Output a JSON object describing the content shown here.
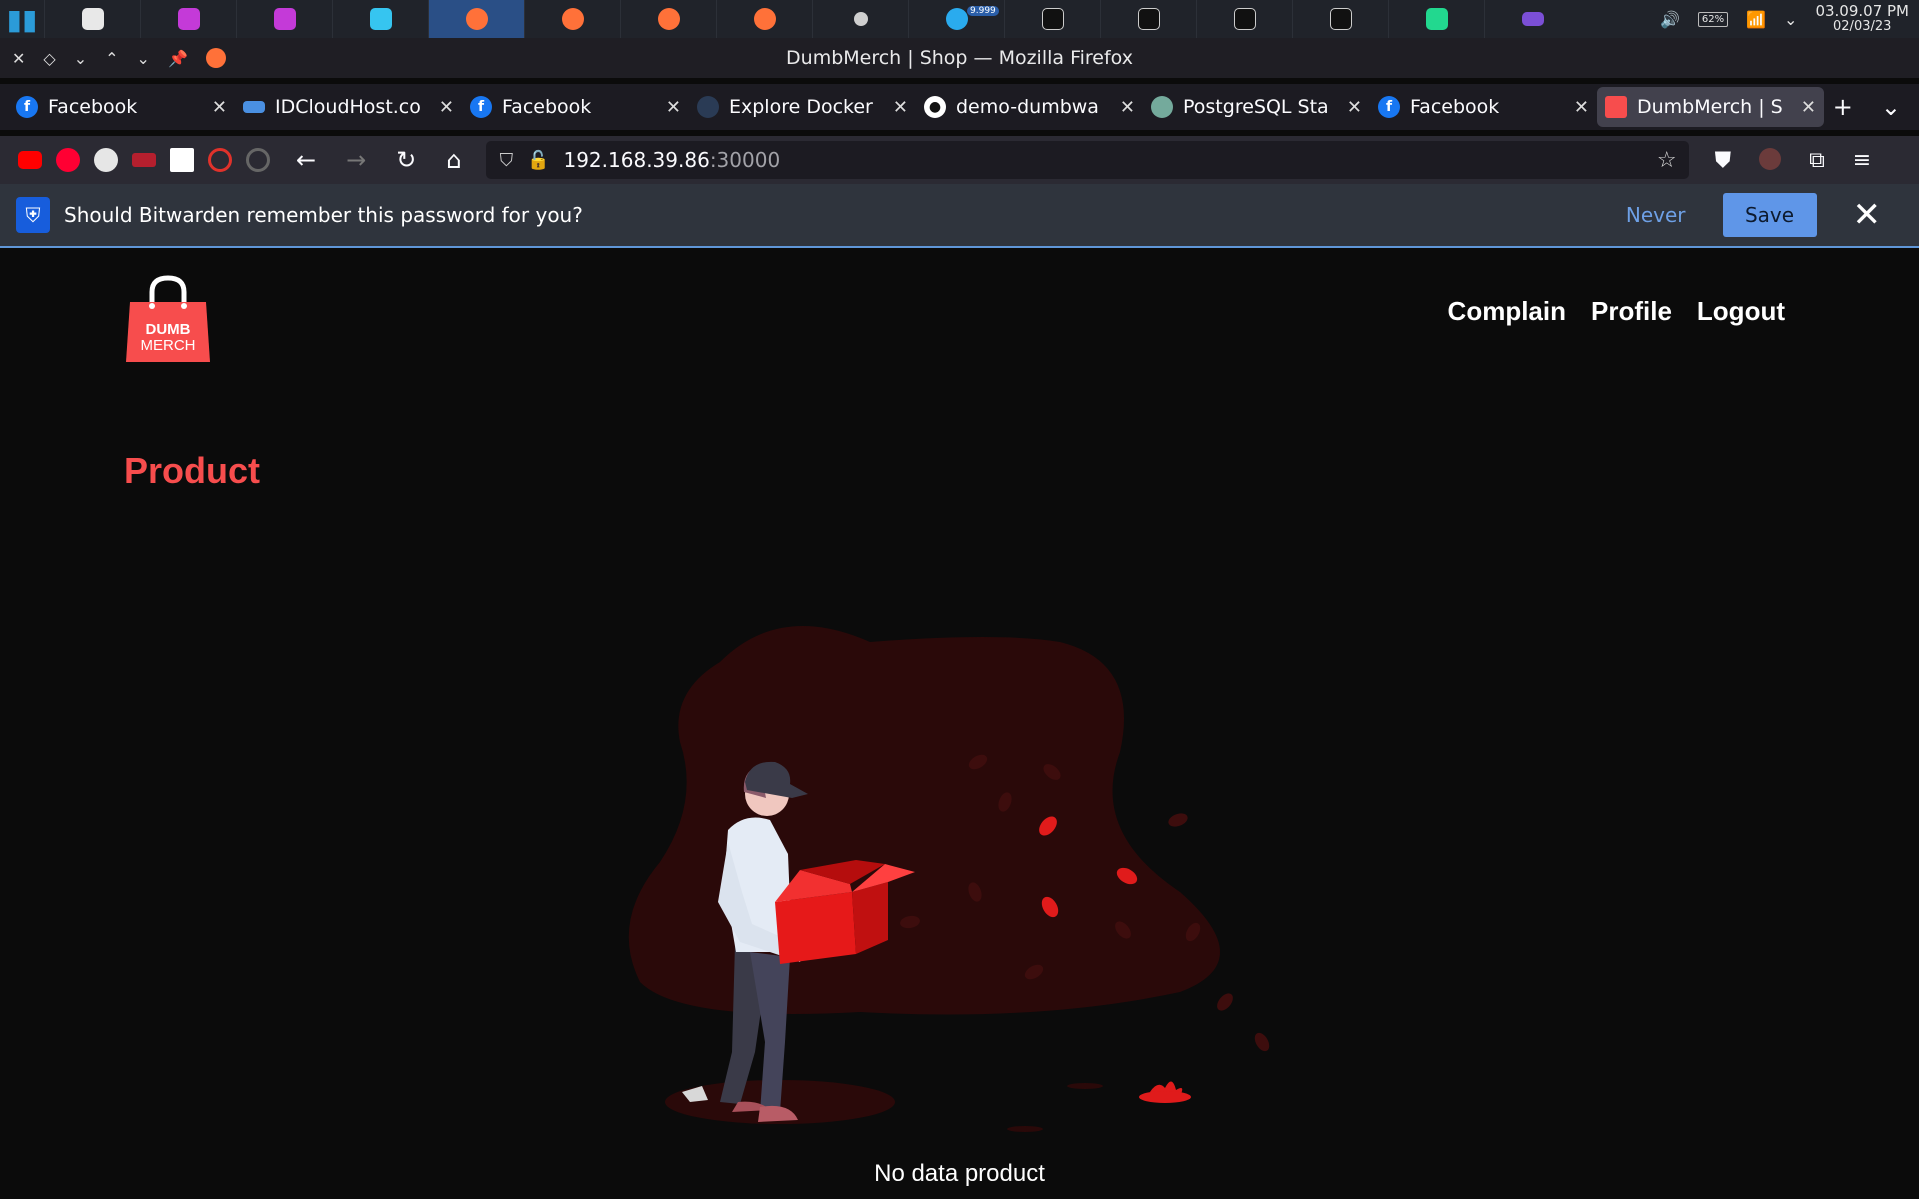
{
  "taskbar": {
    "badge": "9.999",
    "battery": "62%",
    "time": "03.09.07 PM",
    "date": "02/03/23"
  },
  "window": {
    "title": "DumbMerch | Shop — Mozilla Firefox"
  },
  "tabs": [
    {
      "label": "Facebook",
      "icon": "facebook-icon",
      "color": "#1877f2"
    },
    {
      "label": "IDCloudHost.co",
      "icon": "cloud-icon",
      "color": "#4a90e2"
    },
    {
      "label": "Facebook",
      "icon": "facebook-icon",
      "color": "#1877f2"
    },
    {
      "label": "Explore Docker",
      "icon": "docker-icon",
      "color": "#2a3b55"
    },
    {
      "label": "demo-dumbwa",
      "icon": "github-icon",
      "color": "#ffffff"
    },
    {
      "label": "PostgreSQL Sta",
      "icon": "chatgpt-icon",
      "color": "#74aa9c"
    },
    {
      "label": "Facebook",
      "icon": "facebook-icon",
      "color": "#1877f2"
    },
    {
      "label": "DumbMerch | S",
      "icon": "dumbmerch-icon",
      "color": "#f74d4d"
    }
  ],
  "address": {
    "host": "192.168.39.86",
    "port": ":30000"
  },
  "bitwarden": {
    "message": "Should Bitwarden remember this password for you?",
    "never_label": "Never",
    "save_label": "Save"
  },
  "site": {
    "logo_line1": "DUMB",
    "logo_line2": "MERCH",
    "nav": {
      "complain": "Complain",
      "profile": "Profile",
      "logout": "Logout"
    },
    "section_title": "Product",
    "empty_message": "No data product"
  },
  "colors": {
    "accent": "#f74d4d",
    "page_bg": "#0b0b0b"
  }
}
